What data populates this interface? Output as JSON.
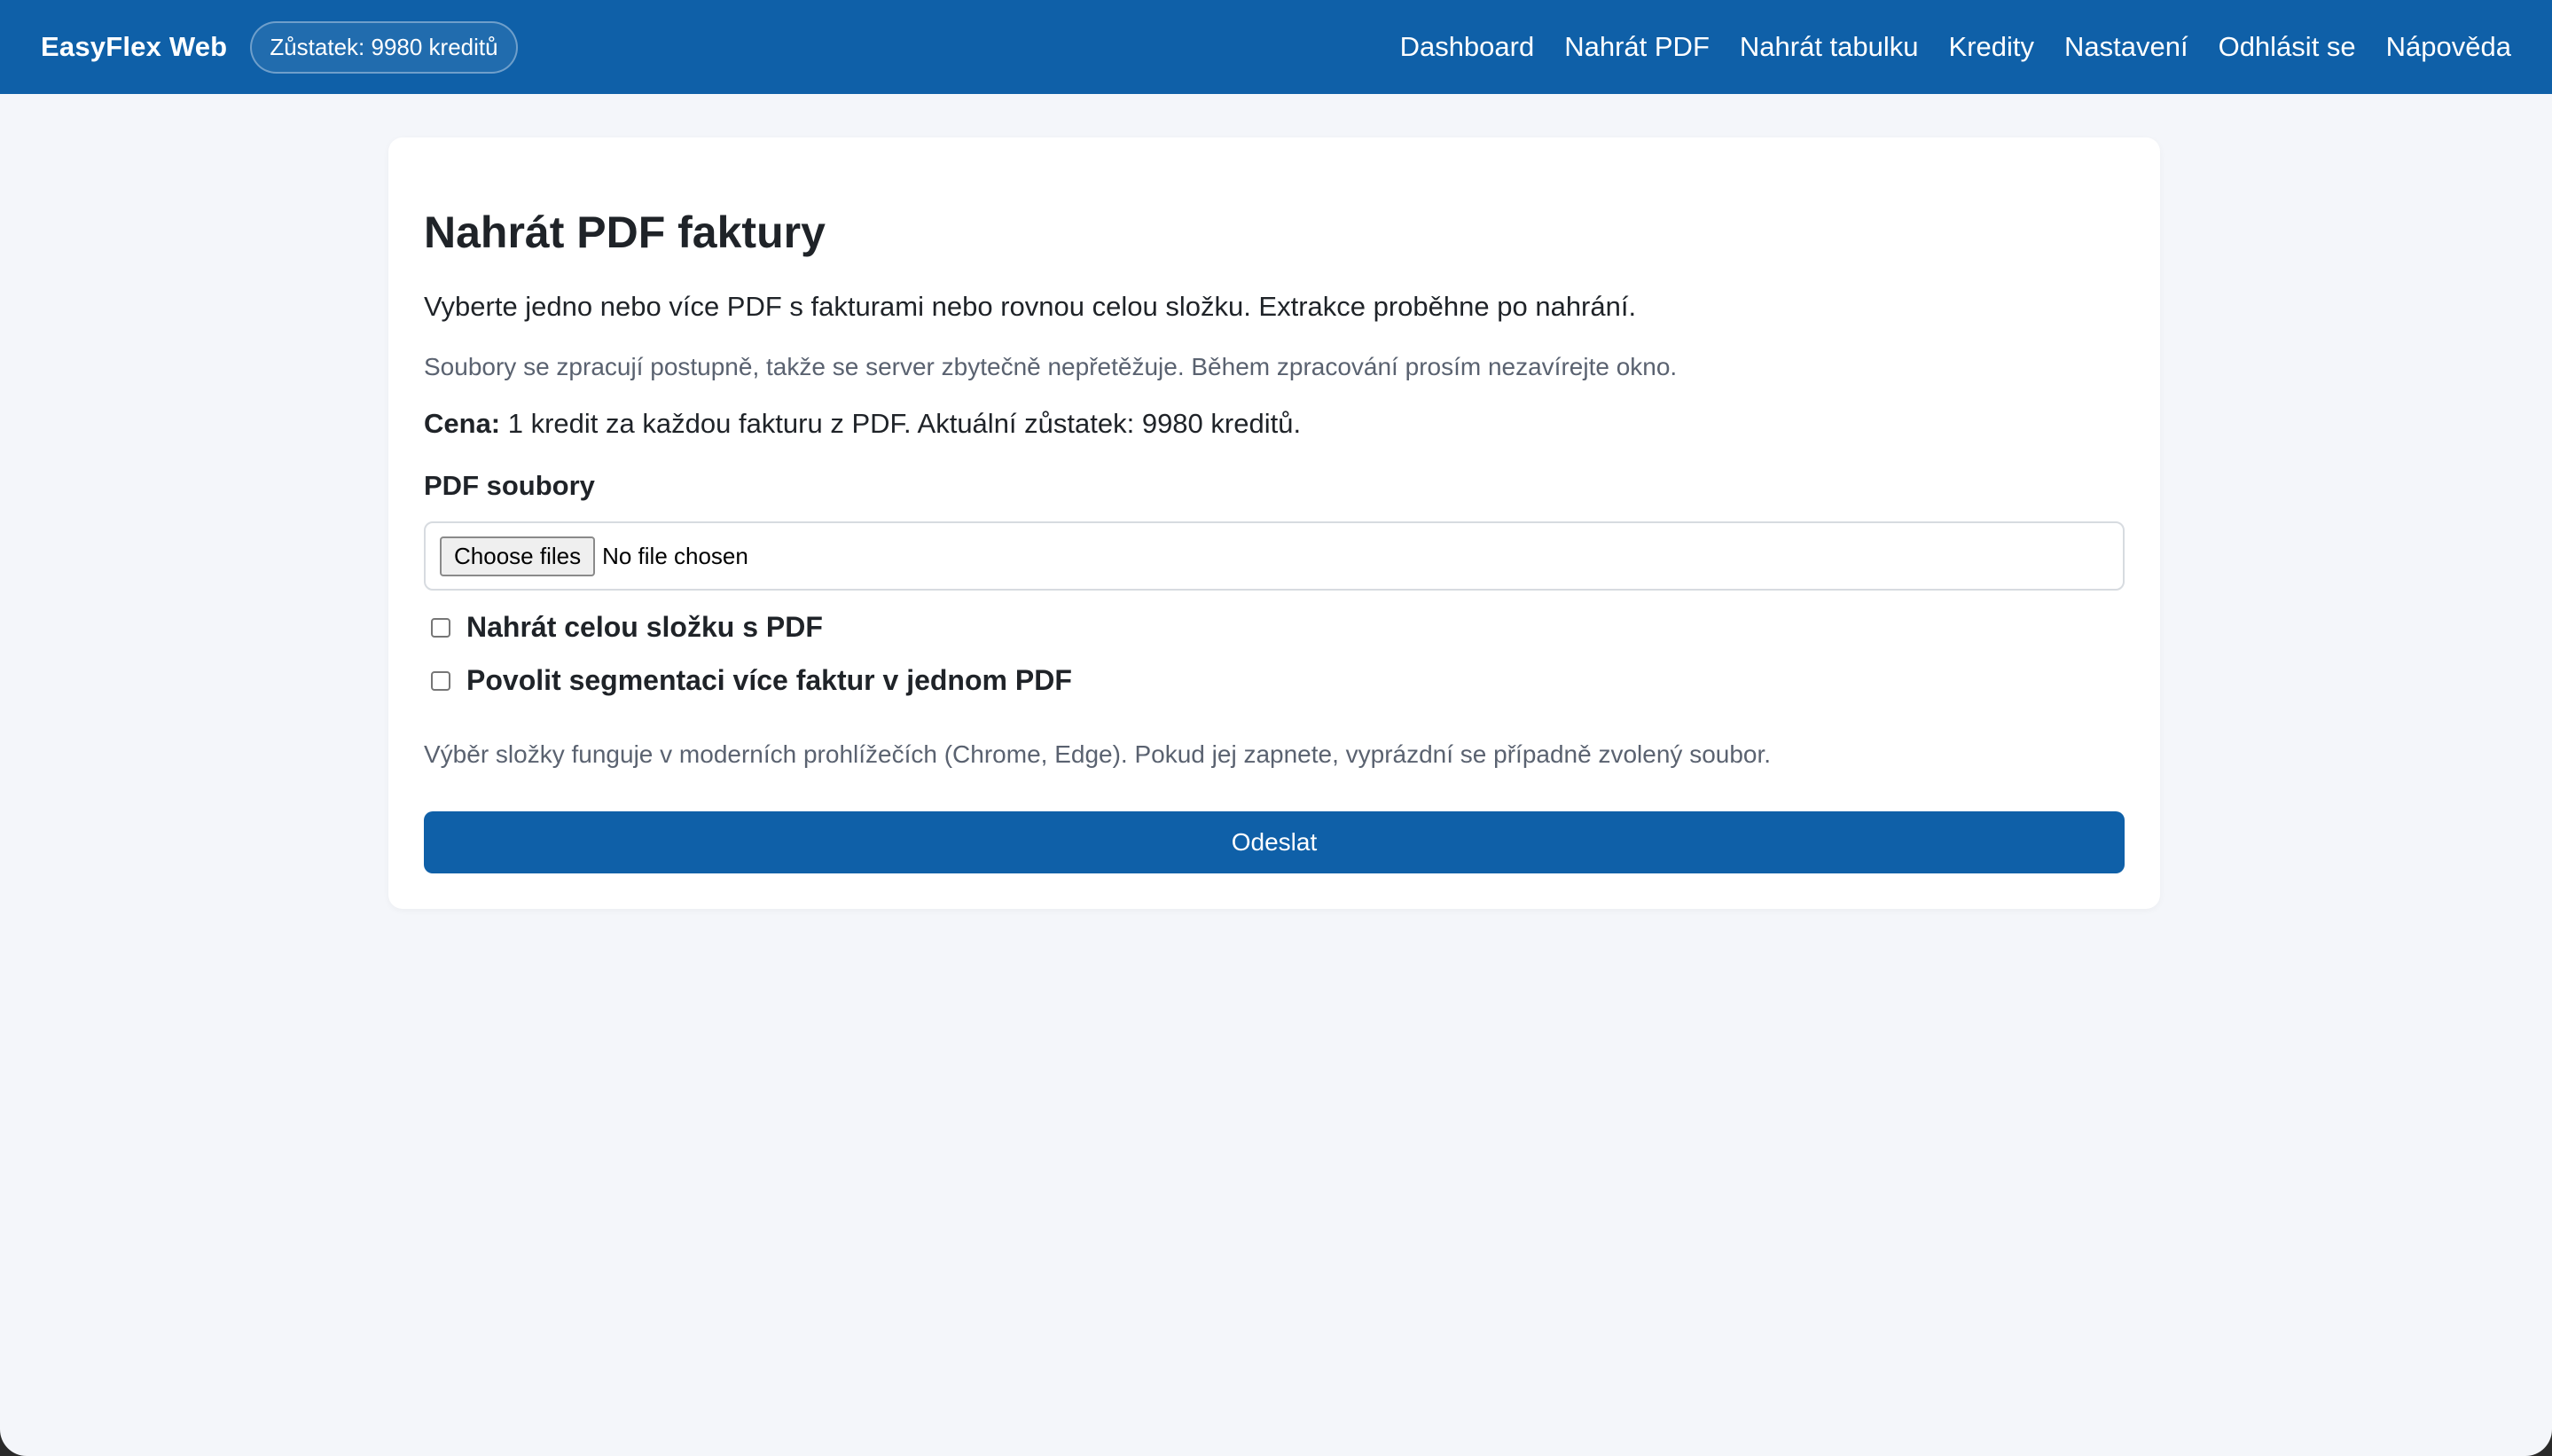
{
  "header": {
    "brand": "EasyFlex Web",
    "balance": "Zůstatek: 9980 kreditů",
    "nav": [
      "Dashboard",
      "Nahrát PDF",
      "Nahrát tabulku",
      "Kredity",
      "Nastavení",
      "Odhlásit se",
      "Nápověda"
    ]
  },
  "main": {
    "title": "Nahrát PDF faktury",
    "intro": "Vyberte jedno nebo více PDF s fakturami nebo rovnou celou složku. Extrakce proběhne po nahrání.",
    "note": "Soubory se zpracují postupně, takže se server zbytečně nepřetěžuje. Během zpracování prosím nezavírejte okno.",
    "price_label": "Cena:",
    "price_text": " 1 kredit za každou fakturu z PDF. Aktuální zůstatek: 9980 kreditů.",
    "file_label": "PDF soubory",
    "choose_button": "Choose files",
    "no_file": "No file chosen",
    "checkbox_folder": "Nahrát celou složku s PDF",
    "checkbox_segment": "Povolit segmentaci více faktur v jednom PDF",
    "hint": "Výběr složky funguje v moderních prohlížečích (Chrome, Edge). Pokud jej zapnete, vyprázdní se případně zvolený soubor.",
    "submit": "Odeslat"
  },
  "colors": {
    "brand_blue": "#0f60a8",
    "page_bg": "#f4f6fa"
  }
}
